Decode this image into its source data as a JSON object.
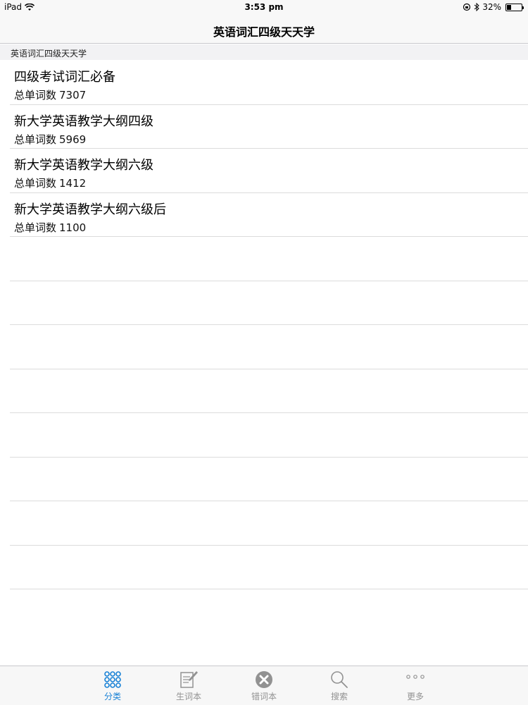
{
  "status_bar": {
    "device": "iPad",
    "time": "3:53 pm",
    "battery": "32%",
    "battery_level": 0.32
  },
  "nav": {
    "title": "英语词汇四级天天学"
  },
  "section": {
    "header": "英语词汇四级天天学"
  },
  "list": {
    "items": [
      {
        "title": "四级考试词汇必备",
        "sub_label": "总单词数",
        "count": "7307"
      },
      {
        "title": "新大学英语教学大纲四级",
        "sub_label": "总单词数",
        "count": "5969"
      },
      {
        "title": "新大学英语教学大纲六级",
        "sub_label": "总单词数",
        "count": "1412"
      },
      {
        "title": "新大学英语教学大纲六级后",
        "sub_label": "总单词数",
        "count": "1100"
      }
    ]
  },
  "tabs": [
    {
      "label": "分类",
      "icon": "grid-dots-icon",
      "active": true
    },
    {
      "label": "生词本",
      "icon": "notebook-pencil-icon",
      "active": false
    },
    {
      "label": "错词本",
      "icon": "x-circle-icon",
      "active": false
    },
    {
      "label": "搜索",
      "icon": "search-icon",
      "active": false
    },
    {
      "label": "更多",
      "icon": "more-dots-icon",
      "active": false
    }
  ],
  "colors": {
    "accent": "#1a82d6",
    "inactive": "#929292"
  }
}
